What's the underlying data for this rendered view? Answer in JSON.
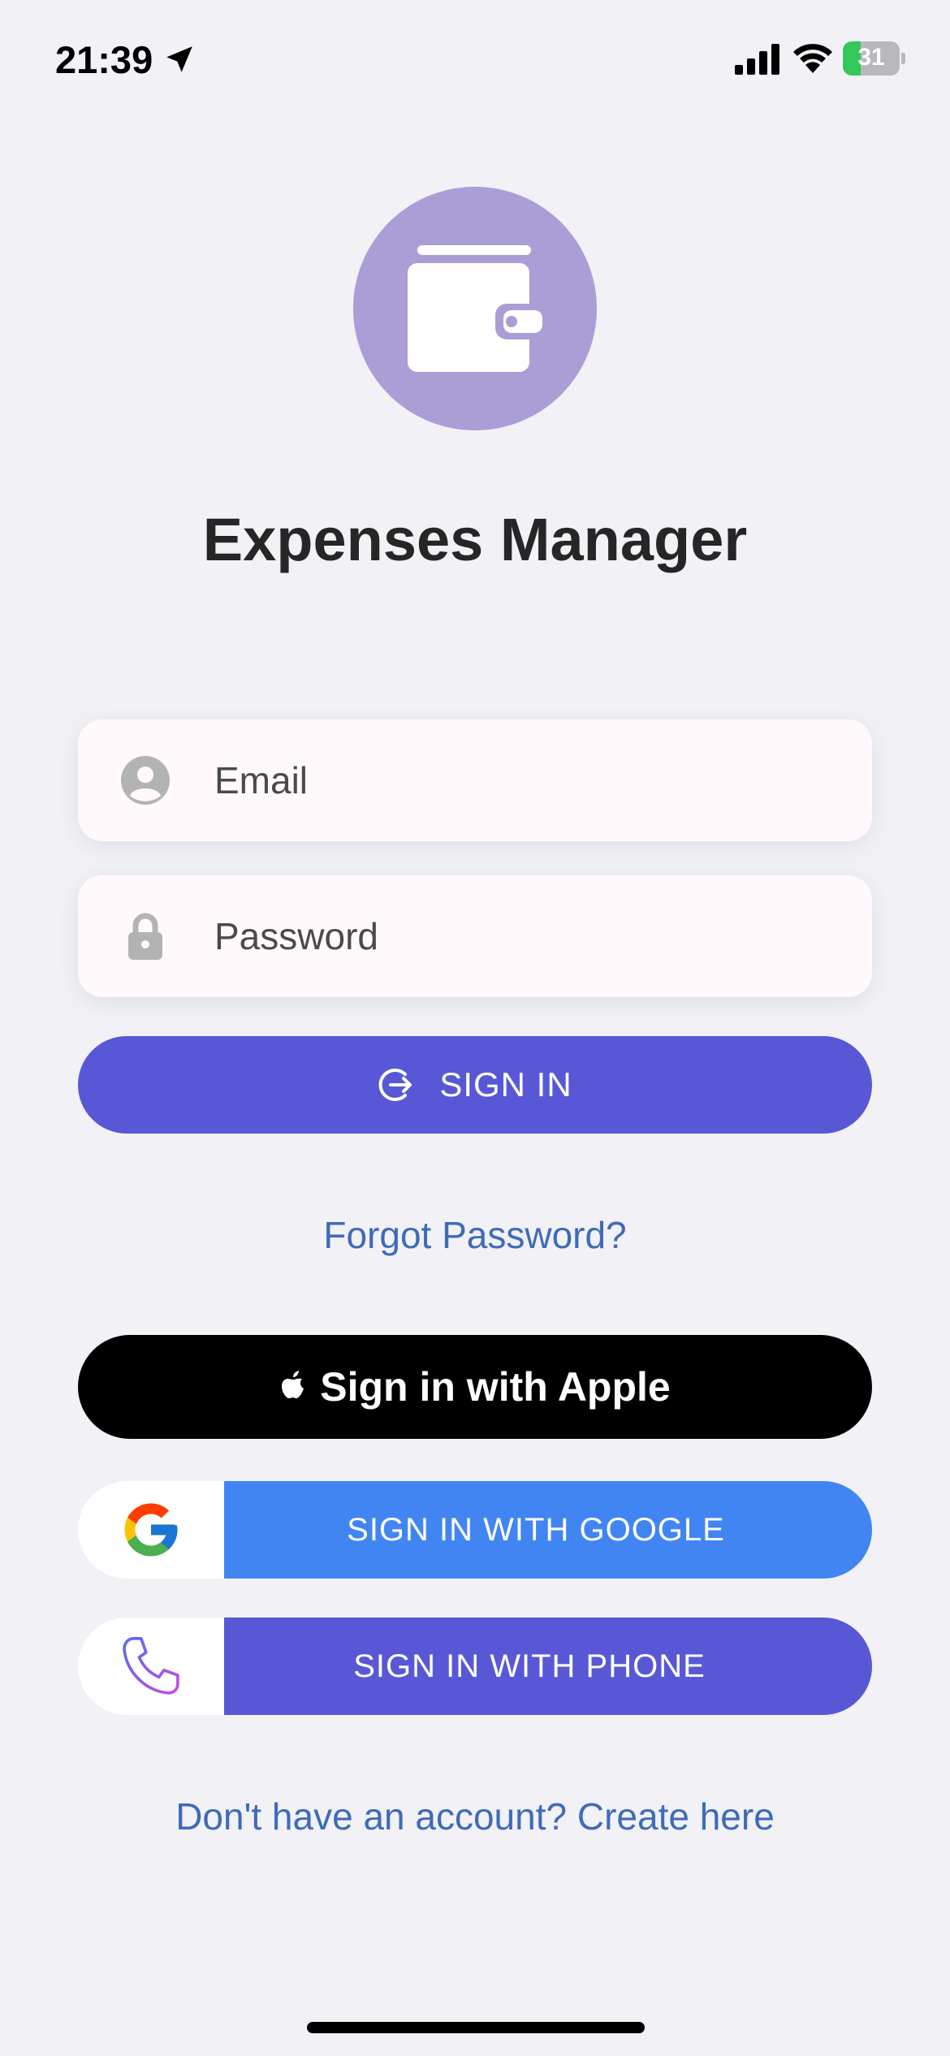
{
  "status_bar": {
    "time": "21:39",
    "battery_percent": "31",
    "battery_level": 0.31,
    "icons": [
      "location-arrow-icon",
      "cellular-signal-icon",
      "wifi-icon",
      "battery-charging-icon"
    ]
  },
  "app": {
    "title": "Expenses Manager",
    "logo_icon": "wallet-icon",
    "logo_color": "#ab9dd6"
  },
  "form": {
    "email_placeholder": "Email",
    "password_placeholder": "Password",
    "email_icon": "user-circle-icon",
    "password_icon": "lock-icon",
    "signin_label": "SIGN IN",
    "signin_icon": "sign-in-icon",
    "forgot_label": "Forgot Password?"
  },
  "social": {
    "apple_label": "Sign in with Apple",
    "google_label": "SIGN IN WITH GOOGLE",
    "phone_label": "SIGN IN WITH PHONE",
    "icons": [
      "apple-logo-icon",
      "google-logo-icon",
      "phone-icon"
    ]
  },
  "footer": {
    "create_account_label": "Don't have an account? Create here"
  },
  "colors": {
    "background": "#f1f1f6",
    "primary": "#5858d6",
    "google": "#4185f2",
    "link": "#3f6bb8",
    "title": "#262626"
  }
}
